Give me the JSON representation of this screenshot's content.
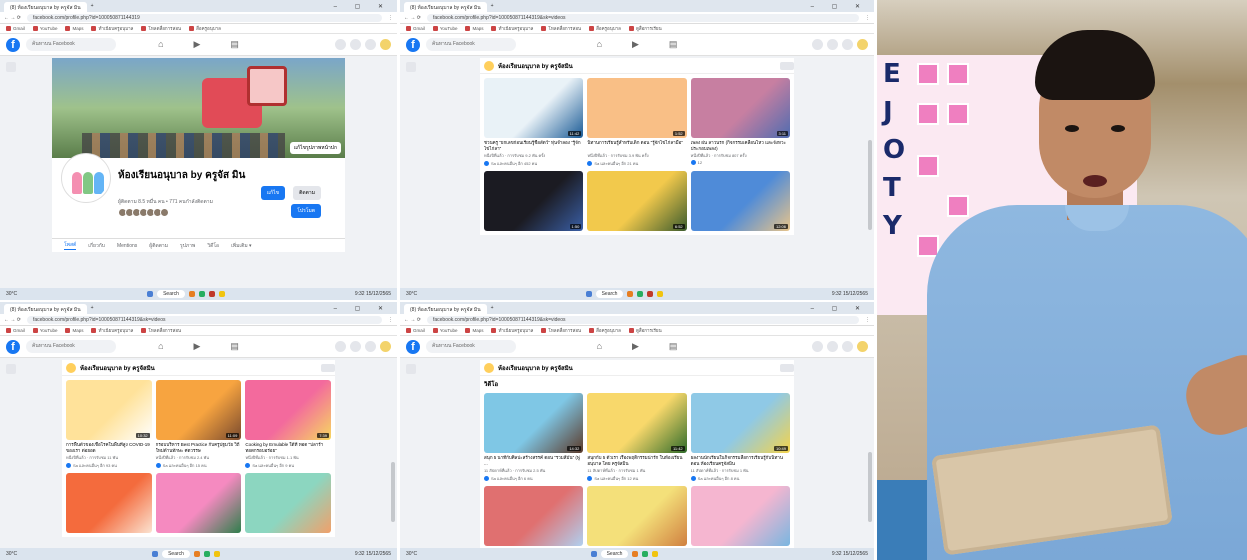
{
  "browser": {
    "tab_title": "(8) ห้องเรียนอนุบาล by ครูจัส มิน",
    "url_page": "facebook.com/profile.php?id=100050871144319",
    "url_videos": "facebook.com/profile.php?id=100050871144319&sk=videos",
    "bookmarks": [
      "Gmail",
      "YouTube",
      "Maps",
      "ทำเนียบครูอนุบาล",
      "โหลดสื่อการสอน",
      "สื่อครูอนุบาล",
      "ดูสื่อการเรียน"
    ]
  },
  "facebook": {
    "search_placeholder": "ค้นหาบน Facebook",
    "page_name": "ห้องเรียนอนุบาล by ครูจัส มิน",
    "page_stats": "ผู้ติดตาม 8.5 หมื่น คน • 771 คนกำลังติดตาม",
    "cover_button": "แก้ไขรูปภาพหน้าปก",
    "btn_edit": "แก้ไข",
    "btn_messenger": "ติดตาม",
    "btn_ads": "โปรโมต",
    "tabs": [
      "โพสต์",
      "เกี่ยวกับ",
      "Mentions",
      "ผู้ติดตาม",
      "รูปภาพ",
      "วิดีโอ",
      "เพิ่มเติม ▾"
    ],
    "videos_header": "ห้องเรียนอนุบาล by ครูจัสมิน",
    "videos_section": "วิดีโอ"
  },
  "videos_top": [
    {
      "title": "ชวนครู \"ยกเลขก่อนเรียนรู้ชื่อสัตว์\" หุ่นจำลอง \"รู้จักไข่ไก่ลา\"",
      "meta": "หนึ่งปีที่แล้ว · การรับชม 9.2 พัน ครั้ง",
      "react": "Sa และคนอื่นๆ อีก 452 คน",
      "dur": "11:42",
      "c1": "#e9f2f7",
      "c2": "#1a5b96"
    },
    {
      "title": "นิทานการเรียนรู้สำหรับเด็ก ตอน \"รู้จักไข่ไก่ลามือ\"",
      "meta": "หนึ่งปีที่แล้ว · การรับชม 3.9 พัน ครั้ง",
      "react": "Sa และคนอื่นๆ อีก 21 คน",
      "dur": "1:52",
      "c1": "#f9bf86",
      "c2": "#f9bf86"
    },
    {
      "title": "เพลง ฝน ลาวนรก (กิจกรรมเคลื่อนไหว และจังหวะประกอบเพลง)",
      "meta": "หนึ่งปีที่แล้ว · การรับชม 807 ครั้ง",
      "react": "12",
      "dur": "3:11",
      "c1": "#c77fa1",
      "c2": "#4f6cb0"
    },
    {
      "title": "",
      "meta": "",
      "react": "",
      "dur": "1:50",
      "c1": "#1b1b22",
      "c2": "#3a5fa6"
    },
    {
      "title": "",
      "meta": "",
      "react": "",
      "dur": "6:52",
      "c1": "#f2c94c",
      "c2": "#3b5b2d"
    },
    {
      "title": "",
      "meta": "",
      "react": "",
      "dur": "12:06",
      "c1": "#4f8bd8",
      "c2": "#e8c48a"
    }
  ],
  "videos_mid": [
    {
      "title": "การฟื้นตัวของเชื้อโรคในพื้นที่สูง COVID-19 ของเรา ต่อยอด",
      "meta": "หนึ่งปีที่แล้ว · การรับชม 11 พัน",
      "react": "Sa และคนอื่นๆ อีก 93 คน",
      "dur": "10:32",
      "c1": "#ffe29a",
      "c2": "#ffffff"
    },
    {
      "title": "กรอบบริหาร Best Practice กับครูปฐมวัย วิถีใหม่ด้านทักษะ ศตวรรษ",
      "meta": "หนึ่งปีที่แล้ว · การรับชม 2.4 พัน",
      "react": "Sa และคนอื่นๆ อีก 15 คน",
      "dur": "11:09",
      "c1": "#f7a440",
      "c2": "#7a4a2e"
    },
    {
      "title": "Cooking by Ernulable ใต้ที่ ทอด \"ปลาร้าทอดกรอบอร่อย\"",
      "meta": "หนึ่งปีที่แล้ว · การรับชม 1.1 พัน",
      "react": "Sa และคนอื่นๆ อีก 9 คน",
      "dur": "7:39",
      "c1": "#f36a9d",
      "c2": "#f6d860"
    },
    {
      "title": "",
      "meta": "",
      "react": "",
      "dur": "",
      "c1": "#f46b3d",
      "c2": "#fbe3d1"
    },
    {
      "title": "",
      "meta": "",
      "react": "",
      "dur": "",
      "c1": "#f58ac0",
      "c2": "#2f7f4c"
    },
    {
      "title": "",
      "meta": "",
      "react": "",
      "dur": "",
      "c1": "#8cd6c0",
      "c2": "#f1a06a"
    }
  ],
  "videos_bottom": [
    {
      "title": "สนุก 5 นาทีกับศิลปะสร้างสรรค์ ตอน \"รวมสีมัน\" (พู่ ...",
      "meta": "11 สัปดาห์ที่แล้ว · การรับชม 2.5 พัน",
      "react": "Sa และคนอื่นๆ อีก 6 คน",
      "dur": "14:32",
      "c1": "#7fc7e5",
      "c2": "#5b3a2a"
    },
    {
      "title": "สนุกกับ 5 ตัวเรา เรื่องพฤติกรรมน่ารัก ในห้องเรียนอนุบาล โดย ครูจัสมิน",
      "meta": "11 สัปดาห์ที่แล้ว · การรับชม 1 พัน",
      "react": "Sa และคนอื่นๆ อีก 12 คน",
      "dur": "11:42",
      "c1": "#f8d86b",
      "c2": "#2f6b2a"
    },
    {
      "title": "ผลงานนักเรียนในกิจกรรมสื่อการเรียนรู้กับนิทาน ตอน ห้องเรียนครูจัสมิน",
      "meta": "11 สัปดาห์ที่แล้ว · การรับชม 1 พัน",
      "react": "Sa และคนอื่นๆ อีก 8 คน",
      "dur": "10:49",
      "c1": "#8fc9e6",
      "c2": "#f4d34b"
    },
    {
      "title": "",
      "meta": "",
      "react": "",
      "dur": "",
      "c1": "#e07070",
      "c2": "#b0d0f0"
    },
    {
      "title": "",
      "meta": "",
      "react": "",
      "dur": "",
      "c1": "#f4e07a",
      "c2": "#d08040"
    },
    {
      "title": "",
      "meta": "",
      "react": "",
      "dur": "",
      "c1": "#f5b6d0",
      "c2": "#79b6e0"
    }
  ],
  "taskbar": {
    "weather": "30°C",
    "search": "Search",
    "time": "9:32",
    "date": "15/12/2565"
  },
  "webcam": {
    "letters": [
      "E",
      "J",
      "O",
      "T",
      "Y"
    ]
  }
}
